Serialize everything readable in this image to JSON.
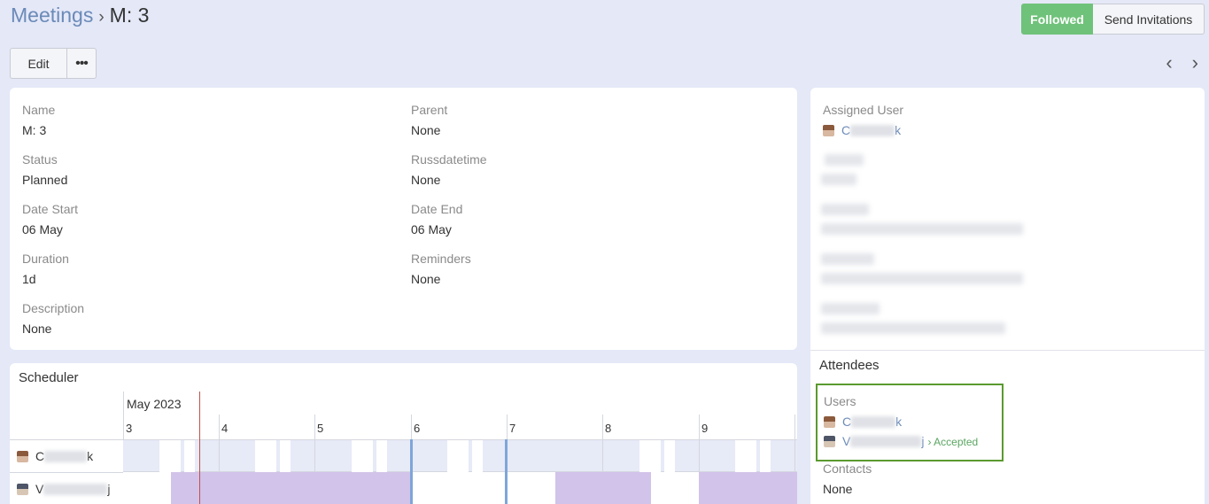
{
  "breadcrumb": {
    "parent": "Meetings",
    "separator": "›",
    "current": "M: 3"
  },
  "header_actions": {
    "followed": "Followed",
    "send_invitations": "Send Invitations"
  },
  "action_bar": {
    "edit": "Edit",
    "more": "•••"
  },
  "nav": {
    "prev": "‹",
    "next": "›"
  },
  "fields": {
    "name": {
      "label": "Name",
      "value": "M: 3"
    },
    "parent": {
      "label": "Parent",
      "value": "None"
    },
    "status": {
      "label": "Status",
      "value": "Planned"
    },
    "russdatetime": {
      "label": "Russdatetime",
      "value": "None"
    },
    "date_start": {
      "label": "Date Start",
      "value": "06 May"
    },
    "date_end": {
      "label": "Date End",
      "value": "06 May"
    },
    "duration": {
      "label": "Duration",
      "value": "1d"
    },
    "reminders": {
      "label": "Reminders",
      "value": "None"
    },
    "description": {
      "label": "Description",
      "value": "None"
    }
  },
  "side": {
    "assigned_user_label": "Assigned User",
    "assigned_user_first": "C",
    "assigned_user_last": "k",
    "attendees_title": "Attendees",
    "users_label": "Users",
    "user1_first": "C",
    "user1_last": "k",
    "user2_first": "V",
    "user2_last": "j",
    "user2_status": "› Accepted",
    "contacts_label": "Contacts",
    "contacts_value": "None"
  },
  "scheduler": {
    "title": "Scheduler",
    "month": "May 2023",
    "days": [
      "3",
      "4",
      "5",
      "6",
      "7",
      "8",
      "9"
    ],
    "row1_first": "C",
    "row1_last": "k",
    "row2_first": "V",
    "row2_last": "j"
  },
  "colors": {
    "accent": "#6fc27a",
    "link": "#6b8ab8",
    "busy": "#d2c3ea",
    "highlight_border": "#5a9a2f",
    "now_line": "#c0504d"
  }
}
